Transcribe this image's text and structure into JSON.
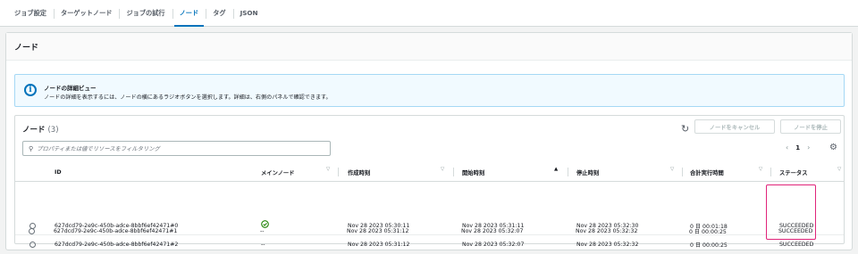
{
  "tabs": [
    "ジョブ設定",
    "ターゲットノード",
    "ジョブの試行",
    "ノード",
    "タグ",
    "JSON"
  ],
  "active_tab": 3,
  "panel_title": "ノード",
  "info": {
    "title": "ノードの詳細ビュー",
    "text": "ノードの詳細を表示するには、ノードの横にあるラジオボタンを選択します。詳細は、右側のパネルで確認できます。"
  },
  "table": {
    "title": "ノード",
    "count": "(3)",
    "cancel_label": "ノードをキャンセル",
    "stop_label": "ノードを停止",
    "filter_placeholder": "プロパティまたは値でリソースをフィルタリング",
    "page": "1",
    "columns": [
      "ID",
      "メインノード",
      "作成時刻",
      "開始時刻",
      "停止時刻",
      "合計実行時間",
      "ステータス"
    ],
    "rows": [
      {
        "id": "627dcd79-2e9c-450b-adce-8bbf6ef42471#0",
        "main": "check",
        "created": "Nov 28 2023 05:30:11",
        "started": "Nov 28 2023 05:31:11",
        "stopped": "Nov 28 2023 05:32:30",
        "duration": "0 日 00:01:18",
        "status": "SUCCEEDED"
      },
      {
        "id": "627dcd79-2e9c-450b-adce-8bbf6ef42471#2",
        "main": "--",
        "created": "Nov 28 2023 05:31:12",
        "started": "Nov 28 2023 05:32:07",
        "stopped": "Nov 28 2023 05:32:32",
        "duration": "0 日 00:00:25",
        "status": "SUCCEEDED"
      },
      {
        "id": "627dcd79-2e9c-450b-adce-8bbf6ef42471#1",
        "main": "--",
        "created": "Nov 28 2023 05:31:12",
        "started": "Nov 28 2023 05:32:07",
        "stopped": "Nov 28 2023 05:32:32",
        "duration": "0 日 00:00:25",
        "status": "SUCCEEDED"
      }
    ]
  },
  "colors": {
    "accent": "#0073bb",
    "success": "#1d8102",
    "highlight": "#e0247a"
  }
}
